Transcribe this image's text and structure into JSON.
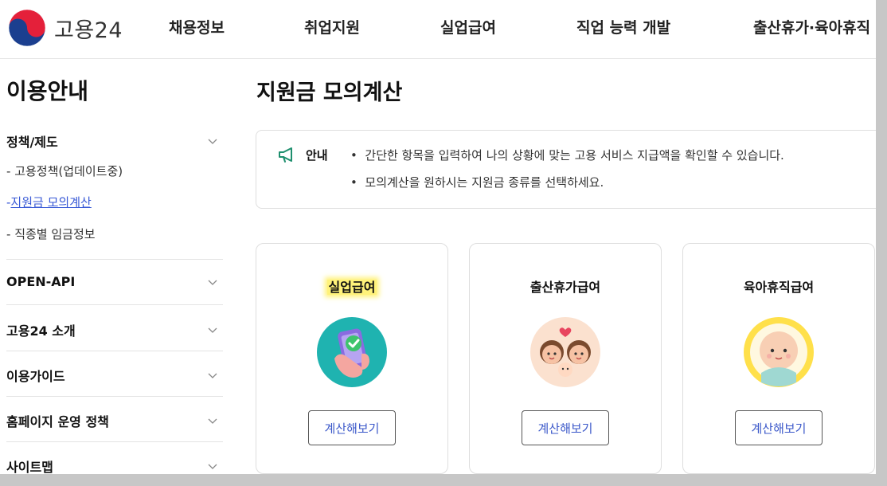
{
  "header": {
    "logo_text": "고용24",
    "nav": [
      "채용정보",
      "취업지원",
      "실업급여",
      "직업 능력 개발",
      "출산휴가·육아휴직"
    ]
  },
  "sidebar": {
    "title": "이용안내",
    "groups": [
      {
        "label": "정책/제도",
        "expanded": true,
        "items": [
          {
            "label": "고용정책(업데이트중)",
            "active": false
          },
          {
            "label": "지원금 모의계산",
            "active": true
          },
          {
            "label": "직종별 임금정보",
            "active": false
          }
        ]
      },
      {
        "label": "OPEN-API"
      },
      {
        "label": "고용24 소개"
      },
      {
        "label": "이용가이드"
      },
      {
        "label": "홈페이지 운영 정책"
      },
      {
        "label": "사이트맵"
      }
    ]
  },
  "main": {
    "title": "지원금 모의계산",
    "notice": {
      "label": "안내",
      "lines": [
        "간단한 항목을 입력하여 나의 상황에 맞는 고용 서비스 지급액을 확인할 수 있습니다.",
        "모의계산을 원하시는 지원금 종류를 선택하세요."
      ]
    },
    "cards": [
      {
        "title": "실업급여",
        "button": "계산해보기",
        "highlighted": true,
        "icon": "phone-hand-check-icon"
      },
      {
        "title": "출산휴가급여",
        "button": "계산해보기",
        "highlighted": false,
        "icon": "parents-baby-icon"
      },
      {
        "title": "육아휴직급여",
        "button": "계산해보기",
        "highlighted": false,
        "icon": "baby-icon"
      }
    ]
  },
  "colors": {
    "accent_blue": "#3859d6",
    "highlight": "#fff27a",
    "teal": "#1fb3b0"
  }
}
